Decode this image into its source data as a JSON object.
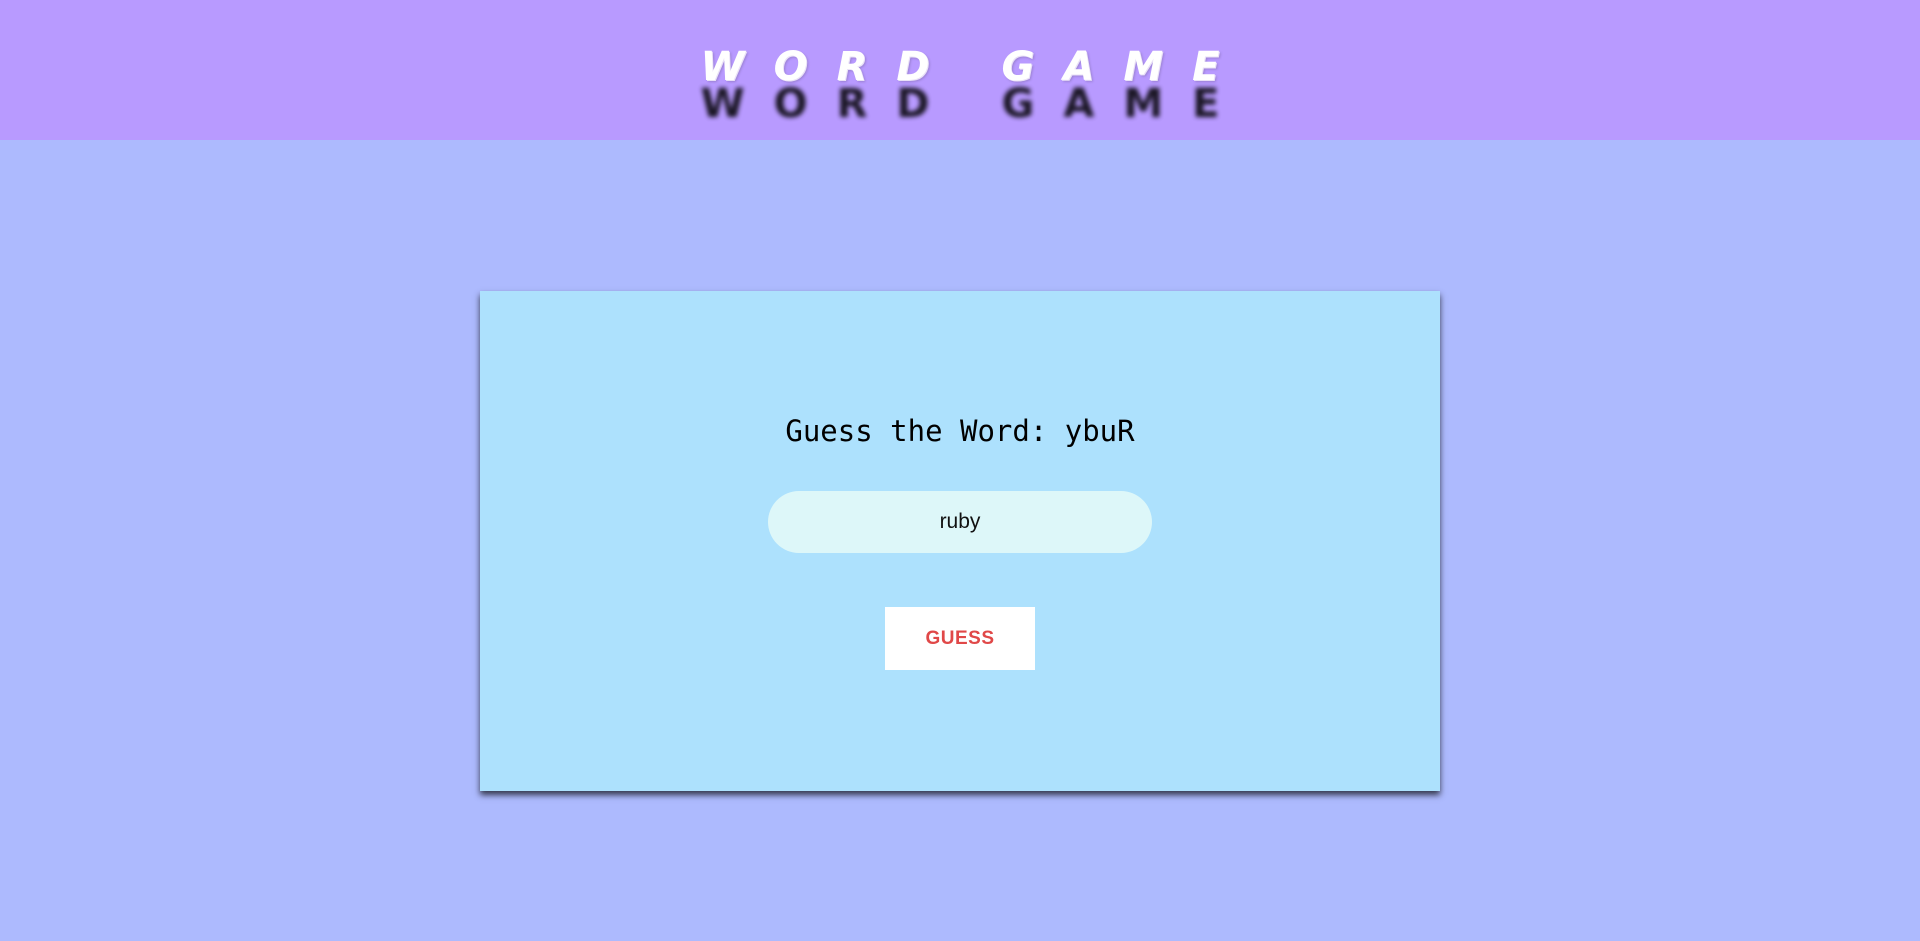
{
  "header": {
    "title": "WORD GAME",
    "background_color": "#b89aff"
  },
  "page": {
    "background_color": "#adbafe"
  },
  "game": {
    "prompt": "Guess the Word: ybuR",
    "guess_input_value": "ruby",
    "guess_button_label": "GUESS",
    "card_color": "#ade1fd",
    "button_text_color": "#e04848"
  }
}
